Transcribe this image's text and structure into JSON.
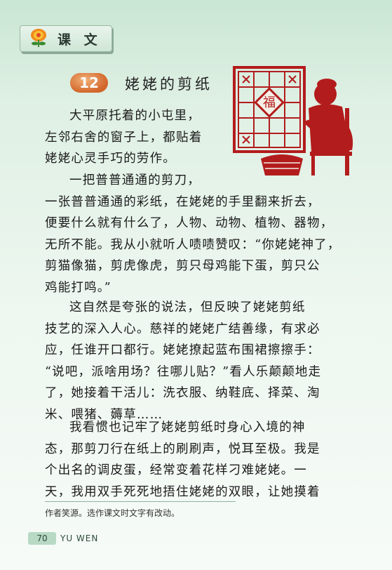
{
  "header": {
    "section_title": "课 文",
    "icon": "flower-icon"
  },
  "lesson": {
    "number": "12",
    "title": "姥姥的剪纸"
  },
  "illustration": {
    "name": "papercut-grandma-illustration",
    "color": "#b31c1c",
    "window_glyph": "福"
  },
  "paragraphs": [
    "大平原托着的小屯里，\n左邻右舍的窗子上，都贴着\n姥姥心灵手巧的劳作。",
    "一把普普通通的剪刀，\n一张普普通通的彩纸，在姥姥的手里翻来折去，\n便要什么就有什么了，人物、动物、植物、器物，\n无所不能。我从小就听人啧啧赞叹：“你姥姥神了，\n剪猫像猫，剪虎像虎，剪只母鸡能下蛋，剪只公\n鸡能打鸣。”",
    "这自然是夸张的说法，但反映了姥姥剪纸\n技艺的深入人心。慈祥的姥姥广结善缘，有求必\n应，任谁开口都行。姥姥撩起蓝布围裙擦擦手：\n“说吧，派啥用场？往哪儿贴？”看人乐颠颠地走\n了，她接着干活儿：洗衣服、纳鞋底、择菜、淘\n米、喂猪、薅草……",
    "我看惯也记牢了姥姥剪纸时身心入境的神\n态，那剪刀行在纸上的刷刷声，悦耳至极。我是\n个出名的调皮蛋，经常变着花样刁难姥姥。一\n天，我用双手死死地捂住姥姥的双眼，让她摸着"
  ],
  "footnote": "作者笑源。选作课文时文字有改动。",
  "footer": {
    "page_number": "70",
    "label": "YU WEN"
  }
}
